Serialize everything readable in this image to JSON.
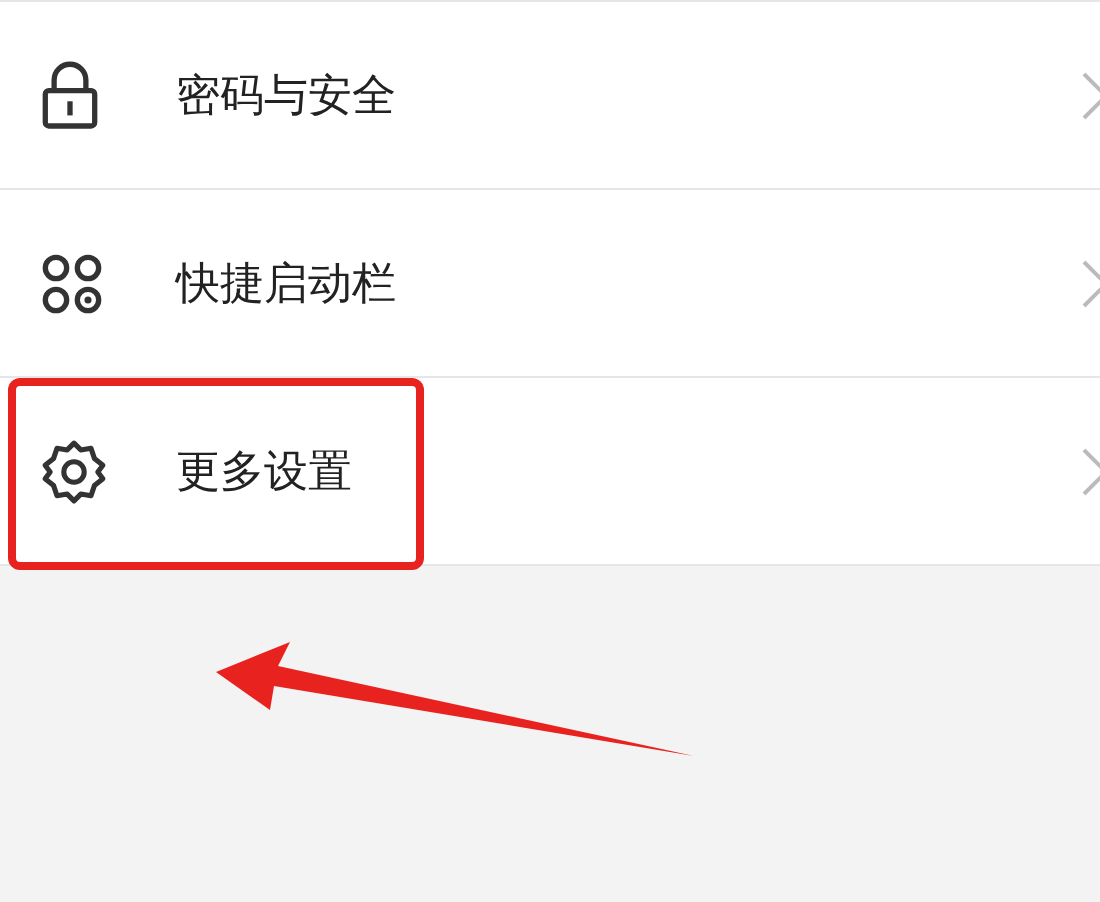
{
  "settings_list": [
    {
      "label": "密码与安全",
      "highlighted": false
    },
    {
      "label": "快捷启动栏",
      "highlighted": false
    },
    {
      "label": "更多设置",
      "highlighted": true
    }
  ]
}
